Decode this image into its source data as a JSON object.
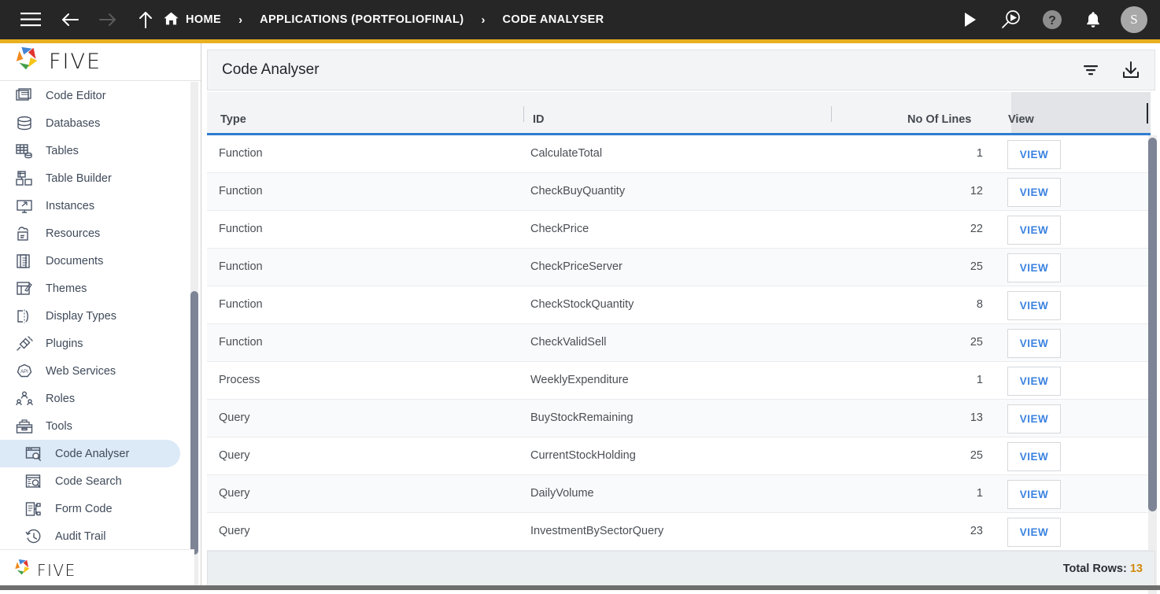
{
  "topbar": {
    "menu_icon": "hamburger-icon",
    "back_icon": "arrow-left-icon",
    "forward_icon": "arrow-right-icon",
    "up_icon": "arrow-up-icon",
    "home_icon": "home-icon",
    "breadcrumbs": [
      {
        "label": "HOME",
        "icon": "home-icon"
      },
      {
        "label": "APPLICATIONS (PORTFOLIOFINAL)"
      },
      {
        "label": "CODE ANALYSER"
      }
    ],
    "separator": "›",
    "tools": [
      {
        "name": "run-icon",
        "label": "Run"
      },
      {
        "name": "search-run-icon",
        "label": "Debug Search"
      },
      {
        "name": "help-icon",
        "label": "Help"
      },
      {
        "name": "notifications-bell-icon",
        "label": "Notifications"
      }
    ],
    "avatar_initial": "S",
    "accent_color": "#e8b021",
    "background_color": "#262626"
  },
  "sidebar": {
    "logo_text": "FIVE",
    "footer_logo_text": "FIVE",
    "items": [
      {
        "label": "Code Editor",
        "icon": "code-editor-icon",
        "level": 0,
        "active": false
      },
      {
        "label": "Databases",
        "icon": "database-icon",
        "level": 0,
        "active": false
      },
      {
        "label": "Tables",
        "icon": "tables-icon",
        "level": 0,
        "active": false
      },
      {
        "label": "Table Builder",
        "icon": "table-builder-icon",
        "level": 0,
        "active": false
      },
      {
        "label": "Instances",
        "icon": "instances-icon",
        "level": 0,
        "active": false
      },
      {
        "label": "Resources",
        "icon": "resources-icon",
        "level": 0,
        "active": false
      },
      {
        "label": "Documents",
        "icon": "documents-icon",
        "level": 0,
        "active": false
      },
      {
        "label": "Themes",
        "icon": "themes-icon",
        "level": 0,
        "active": false
      },
      {
        "label": "Display Types",
        "icon": "display-types-icon",
        "level": 0,
        "active": false
      },
      {
        "label": "Plugins",
        "icon": "plugins-icon",
        "level": 0,
        "active": false
      },
      {
        "label": "Web Services",
        "icon": "web-services-api-icon",
        "level": 0,
        "active": false
      },
      {
        "label": "Roles",
        "icon": "roles-icon",
        "level": 0,
        "active": false
      },
      {
        "label": "Tools",
        "icon": "tools-icon",
        "level": 0,
        "active": false
      },
      {
        "label": "Code Analyser",
        "icon": "code-analyser-icon",
        "level": 1,
        "active": true
      },
      {
        "label": "Code Search",
        "icon": "code-search-icon",
        "level": 1,
        "active": false
      },
      {
        "label": "Form Code",
        "icon": "form-code-icon",
        "level": 1,
        "active": false
      },
      {
        "label": "Audit Trail",
        "icon": "audit-trail-icon",
        "level": 1,
        "active": false
      }
    ],
    "active_highlight_color": "#dce9f7"
  },
  "panel": {
    "title": "Code Analyser",
    "filter_icon": "filter-icon",
    "download_icon": "download-icon"
  },
  "table": {
    "columns": [
      "Type",
      "ID",
      "No Of Lines",
      "View"
    ],
    "header_underline_color": "#2f7dd1",
    "view_button_label": "VIEW",
    "view_button_color": "#3b82e0",
    "rows": [
      {
        "type": "Function",
        "id": "CalculateTotal",
        "lines": "1",
        "view": "VIEW"
      },
      {
        "type": "Function",
        "id": "CheckBuyQuantity",
        "lines": "12",
        "view": "VIEW"
      },
      {
        "type": "Function",
        "id": "CheckPrice",
        "lines": "22",
        "view": "VIEW"
      },
      {
        "type": "Function",
        "id": "CheckPriceServer",
        "lines": "25",
        "view": "VIEW"
      },
      {
        "type": "Function",
        "id": "CheckStockQuantity",
        "lines": "8",
        "view": "VIEW"
      },
      {
        "type": "Function",
        "id": "CheckValidSell",
        "lines": "25",
        "view": "VIEW"
      },
      {
        "type": "Process",
        "id": "WeeklyExpenditure",
        "lines": "1",
        "view": "VIEW"
      },
      {
        "type": "Query",
        "id": "BuyStockRemaining",
        "lines": "13",
        "view": "VIEW"
      },
      {
        "type": "Query",
        "id": "CurrentStockHolding",
        "lines": "25",
        "view": "VIEW"
      },
      {
        "type": "Query",
        "id": "DailyVolume",
        "lines": "1",
        "view": "VIEW"
      },
      {
        "type": "Query",
        "id": "InvestmentBySectorQuery",
        "lines": "23",
        "view": "VIEW"
      }
    ]
  },
  "footer": {
    "total_rows_label": "Total Rows:",
    "total_rows_value": "13",
    "value_color": "#d08a11"
  },
  "annotation": {
    "arrow_color": "#e01b1b",
    "points_to": "view-button-row-1"
  }
}
